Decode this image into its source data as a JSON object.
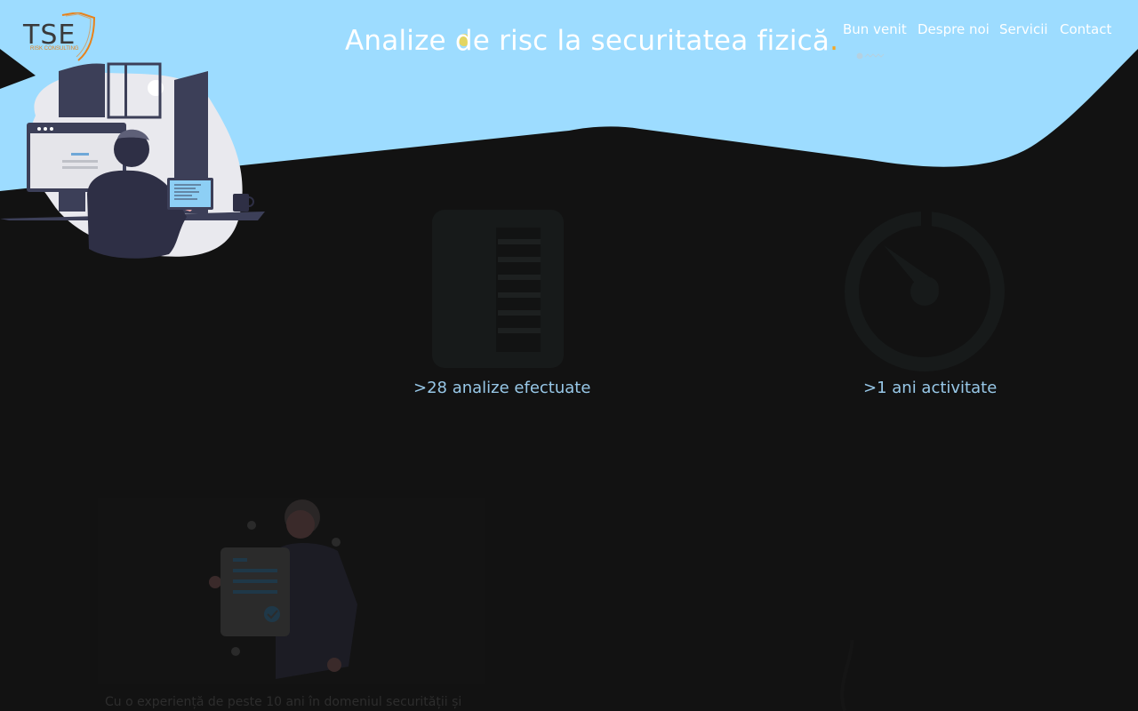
{
  "brand": {
    "name": "TSE",
    "subtitle": "RISK CONSULTING",
    "accent": "#e8821a",
    "hero_color": "#9ddcff"
  },
  "hero": {
    "title": "Analize de risc la securitatea fizică",
    "title_dot": "."
  },
  "nav": {
    "items": [
      {
        "label": "Bun venit"
      },
      {
        "label": "Despre noi"
      },
      {
        "label": "Servicii"
      },
      {
        "label": "Contact"
      }
    ]
  },
  "stats": [
    {
      "icon": "document-icon",
      "label": ">28 analize efectuate"
    },
    {
      "icon": "stopwatch-icon",
      "label": ">1 ani activitate"
    }
  ],
  "about": {
    "text": "Cu o experiență de peste 10 ani în domeniul securității și"
  }
}
